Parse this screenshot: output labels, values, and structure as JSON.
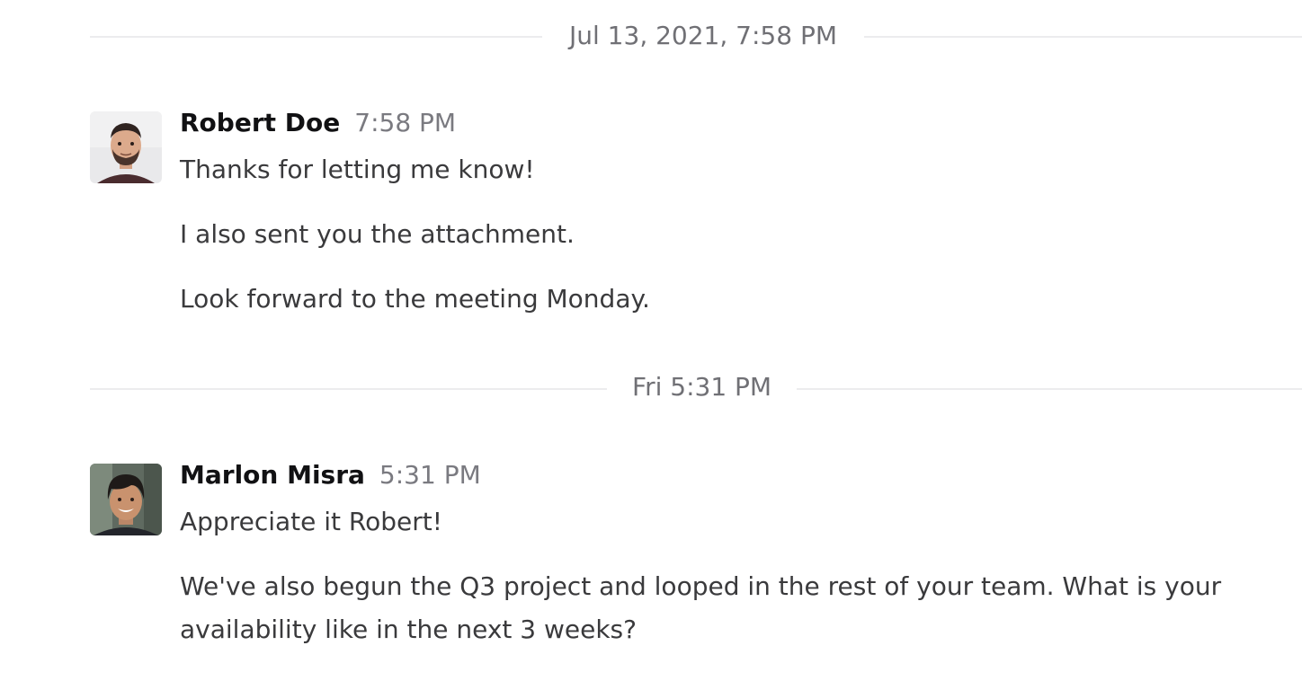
{
  "dividers": [
    {
      "label": "Jul 13, 2021, 7:58 PM"
    },
    {
      "label": "Fri 5:31 PM"
    }
  ],
  "messages": [
    {
      "author": "Robert Doe",
      "time": "7:58 PM",
      "avatar_icon": "person-avatar-robert",
      "lines": [
        "Thanks for letting me know!",
        "I also sent you the attachment.",
        "Look forward to the meeting Monday."
      ]
    },
    {
      "author": "Marlon Misra",
      "time": "5:31 PM",
      "avatar_icon": "person-avatar-marlon",
      "lines": [
        "Appreciate it Robert!",
        "We've also begun the Q3 project and looped in the rest of your team. What is your availability like in the next 3 weeks?"
      ]
    }
  ],
  "colors": {
    "divider": "#ececee",
    "timestamp": "#707075",
    "author": "#111113",
    "body_text": "#3a3a3c"
  }
}
